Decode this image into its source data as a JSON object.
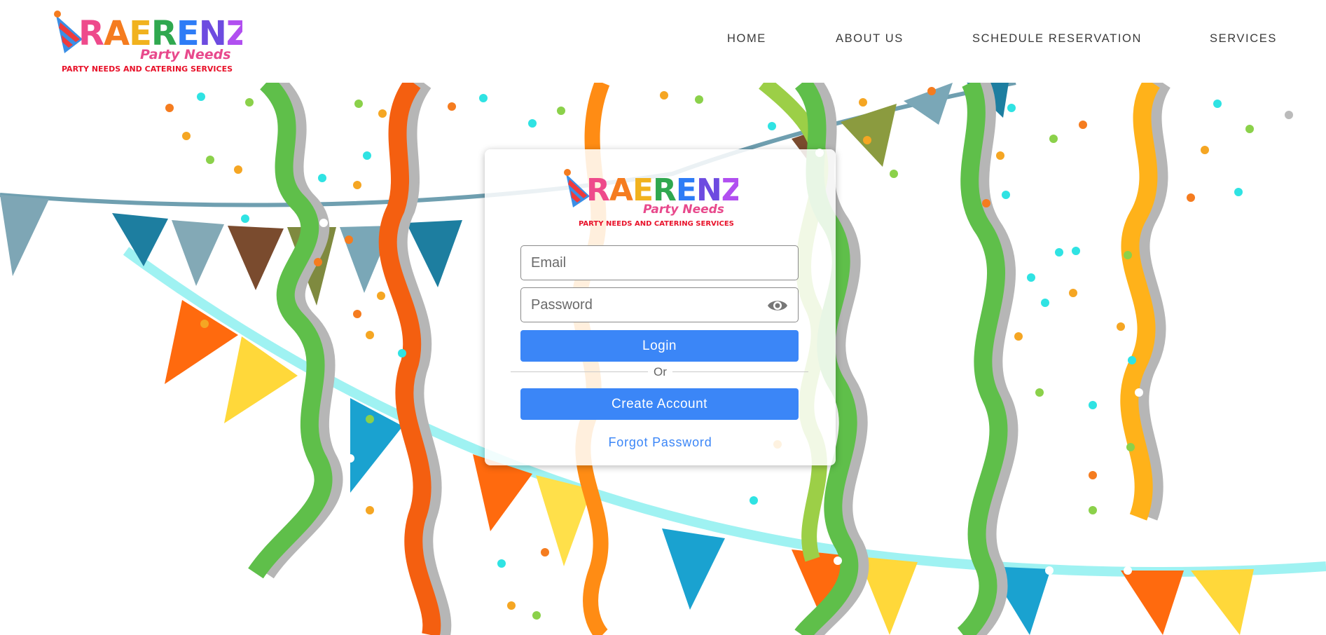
{
  "brand": {
    "name": "RAERENZ",
    "subtitle": "Party Needs",
    "tagline": "PARTY NEEDS AND CATERING SERVICES",
    "letter_colors": [
      "#ee4a8b",
      "#f57c1f",
      "#f1b21e",
      "#2fa84f",
      "#2e7cf6",
      "#6d4be0",
      "#b14ff0"
    ],
    "subtitle_color": "#e8498c",
    "tagline_color": "#e8122a"
  },
  "nav": {
    "items": [
      "HOME",
      "ABOUT US",
      "SCHEDULE RESERVATION",
      "SERVICES"
    ]
  },
  "login": {
    "email_placeholder": "Email",
    "password_placeholder": "Password",
    "login_label": "Login",
    "or_label": "Or",
    "create_label": "Create Account",
    "forgot_label": "Forgot Password"
  },
  "colors": {
    "primary": "#3b86f7",
    "text_nav": "#3a3a3a"
  }
}
